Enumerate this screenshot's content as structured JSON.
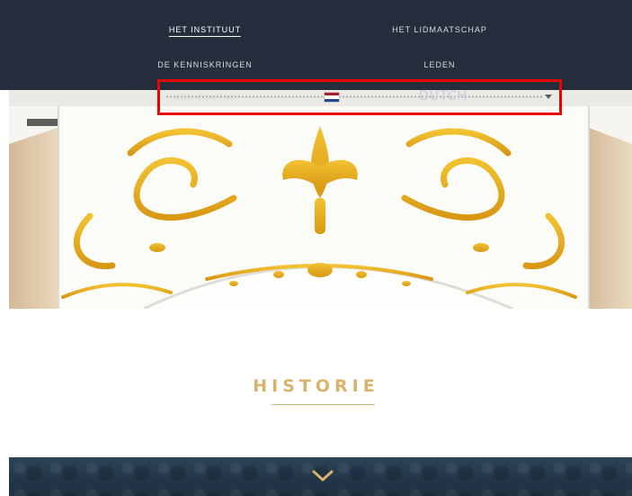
{
  "nav": {
    "items": [
      {
        "label": "HET INSTITUUT",
        "active": true
      },
      {
        "label": "HET LIDMAATSCHAP",
        "active": false
      },
      {
        "label": "DE KENNISKRINGEN",
        "active": false
      },
      {
        "label": "LEDEN",
        "active": false
      }
    ],
    "contact_label": "KEN CONTACT"
  },
  "language": {
    "selected": "DUTCH",
    "flag_icon": "netherlands-flag-icon"
  },
  "section": {
    "title": "HISTORIE"
  },
  "colors": {
    "nav_bg": "#262d3c",
    "accent_gold": "#d8b36a",
    "highlight_red": "#ee0000",
    "band_bg": "#223647"
  },
  "icons": {
    "dropdown": "caret-down-icon",
    "scroll": "chevron-down-icon"
  }
}
